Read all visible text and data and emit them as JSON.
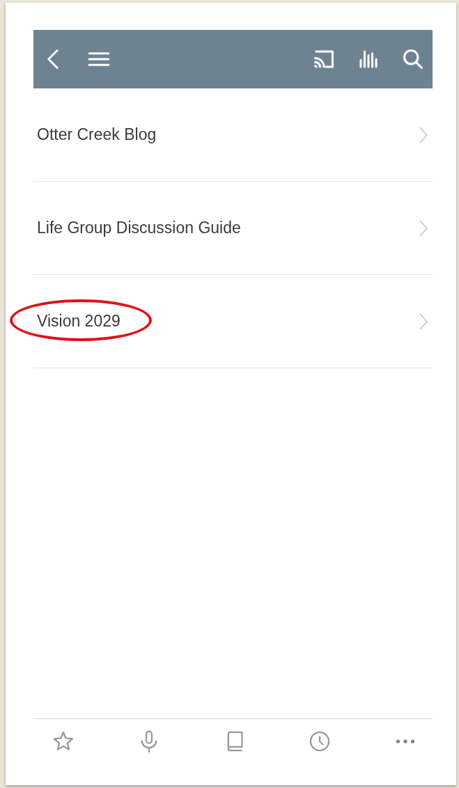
{
  "toolbar": {
    "buttons": [
      {
        "kind": "back"
      },
      {
        "kind": "menu"
      },
      {
        "kind": "cast"
      },
      {
        "kind": "levels"
      },
      {
        "kind": "search"
      }
    ]
  },
  "list": {
    "items": [
      {
        "label": "Otter Creek Blog",
        "circled": false
      },
      {
        "label": "Life Group Discussion Guide",
        "circled": false
      },
      {
        "label": "Vision 2029",
        "circled": true
      }
    ]
  },
  "tab_bar": {
    "tabs": [
      {
        "kind": "star",
        "selected": false
      },
      {
        "kind": "mic",
        "selected": false
      },
      {
        "kind": "book",
        "selected": false
      },
      {
        "kind": "clock",
        "selected": false
      },
      {
        "kind": "more",
        "selected": true
      }
    ]
  }
}
